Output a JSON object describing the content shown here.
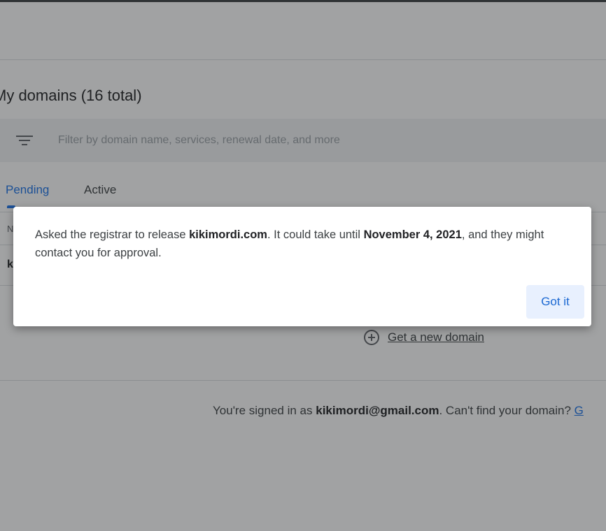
{
  "page": {
    "title": "My domains (16 total)"
  },
  "filter": {
    "placeholder": "Filter by domain name, services, renewal date, and more",
    "icon": "filter-icon"
  },
  "tabs": [
    {
      "label": "Pending",
      "selected": true
    },
    {
      "label": "Active",
      "selected": false
    }
  ],
  "table": {
    "column_header_partial": "N",
    "row_partial": "k"
  },
  "new_domain": {
    "label": "Get a new domain",
    "icon": "plus-circle-icon"
  },
  "footer": {
    "prefix": "You're signed in as ",
    "email": "kikimordi@gmail.com",
    "suffix": ". Can't find your domain? ",
    "link_partial": "G"
  },
  "dialog": {
    "text_1": "Asked the registrar to release ",
    "domain": "kikimordi.com",
    "text_2": ". It could take until ",
    "date": "November 4, 2021",
    "text_3": ", and they might contact you for approval.",
    "button_label": "Got it"
  },
  "colors": {
    "accent": "#1a73e8",
    "scrim": "#202124",
    "button_bg": "#e8f0fe"
  }
}
